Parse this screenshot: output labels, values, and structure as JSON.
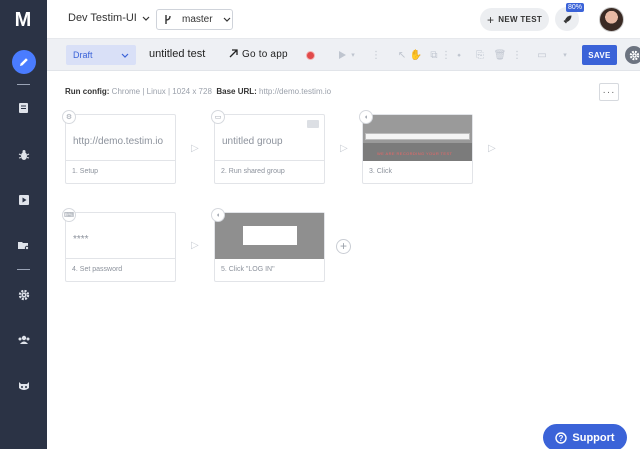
{
  "app": {
    "logo": "M"
  },
  "sidebar": {
    "items": [
      {
        "name": "edit",
        "icon": "pencil-icon",
        "active": true
      },
      {
        "name": "tests",
        "icon": "document-icon"
      },
      {
        "name": "bugs",
        "icon": "bug-icon"
      },
      {
        "name": "runs",
        "icon": "play-icon"
      },
      {
        "name": "suites",
        "icon": "folder-gear-icon"
      },
      {
        "name": "settings",
        "icon": "gear-icon"
      },
      {
        "name": "team",
        "icon": "users-icon"
      },
      {
        "name": "extension",
        "icon": "mask-icon"
      }
    ]
  },
  "topbar": {
    "project": "Dev Testim-UI",
    "branch": "master",
    "new_test_label": "NEW TEST",
    "badge_percent": "80%"
  },
  "toolbar": {
    "status": "Draft",
    "test_name": "untitled test",
    "go_to_app": "Go to app",
    "save_label": "SAVE"
  },
  "run_config": {
    "label": "Run config:",
    "value": "Chrome | Linux | 1024 x 728",
    "base_url_label": "Base URL:",
    "base_url": "http://demo.testim.io"
  },
  "steps": [
    {
      "text": "http://demo.testim.io",
      "label": "1. Setup",
      "icon": "setup-icon"
    },
    {
      "text": "untitled group",
      "label": "2. Run shared group",
      "icon": "folder-icon"
    },
    {
      "label": "3. Click",
      "icon": "mouse-icon",
      "screenshot_text": "WE ARE RECORDING YOUR TEST"
    },
    {
      "text": "****",
      "label": "4. Set password",
      "icon": "keyboard-icon"
    },
    {
      "label": "5. Click \"LOG IN\"",
      "icon": "mouse-icon"
    }
  ],
  "support_label": "Support",
  "colors": {
    "accent": "#3b63d8",
    "sidebar": "#2b3345",
    "record": "#e14a4a"
  }
}
